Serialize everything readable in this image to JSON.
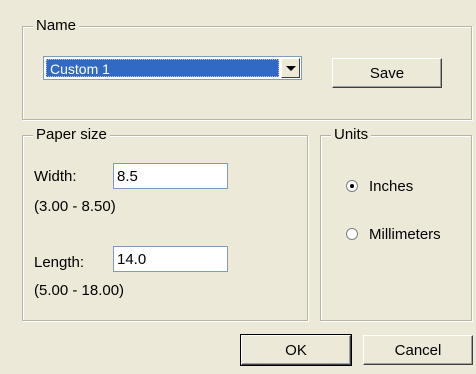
{
  "name_group": {
    "legend": "Name",
    "selected": "Custom 1",
    "save_label": "Save"
  },
  "paper_size": {
    "legend": "Paper size",
    "width_label": "Width:",
    "width_value": "8.5",
    "width_range": "(3.00 - 8.50)",
    "length_label": "Length:",
    "length_value": "14.0",
    "length_range": "(5.00 - 18.00)"
  },
  "units": {
    "legend": "Units",
    "options": [
      {
        "label": "Inches",
        "selected": true
      },
      {
        "label": "Millimeters",
        "selected": false
      }
    ]
  },
  "footer": {
    "ok_label": "OK",
    "cancel_label": "Cancel"
  },
  "colors": {
    "dialog_bg": "#ece9d8",
    "selection": "#316ac5"
  }
}
